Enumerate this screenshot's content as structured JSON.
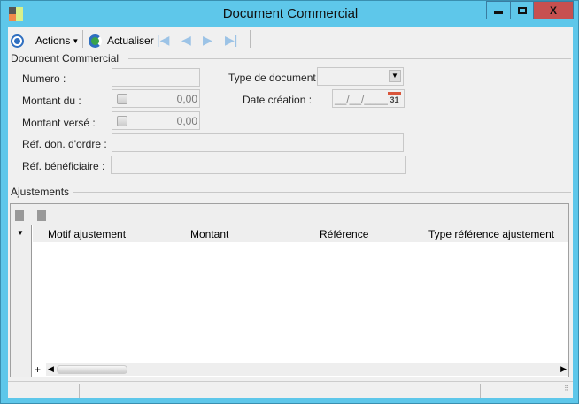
{
  "window": {
    "title": "Document Commercial",
    "minimize": "_",
    "maximize": "□",
    "close": "X"
  },
  "toolbar": {
    "actions_label": "Actions",
    "refresh_label": "Actualiser"
  },
  "form": {
    "group_title": "Document Commercial",
    "numero_label": "Numero :",
    "numero_value": "",
    "type_doc_label": "Type de document :",
    "type_doc_value": "",
    "montant_du_label": "Montant du :",
    "montant_du_value": "0,00",
    "date_creation_label": "Date création :",
    "date_creation_value": "__/__/____",
    "calendar_day": "31",
    "montant_verse_label": "Montant versé :",
    "montant_verse_value": "0,00",
    "ref_donneur_label": "Réf. don. d'ordre :",
    "ref_donneur_value": "",
    "ref_benef_label": "Réf. bénéficiaire :",
    "ref_benef_value": ""
  },
  "ajustements": {
    "group_title": "Ajustements",
    "columns": [
      "Motif ajustement",
      "Montant",
      "Référence",
      "Type référence ajustement"
    ],
    "add_label": "+"
  },
  "colors": {
    "border": "#5ec7ea",
    "close": "#c75050"
  }
}
